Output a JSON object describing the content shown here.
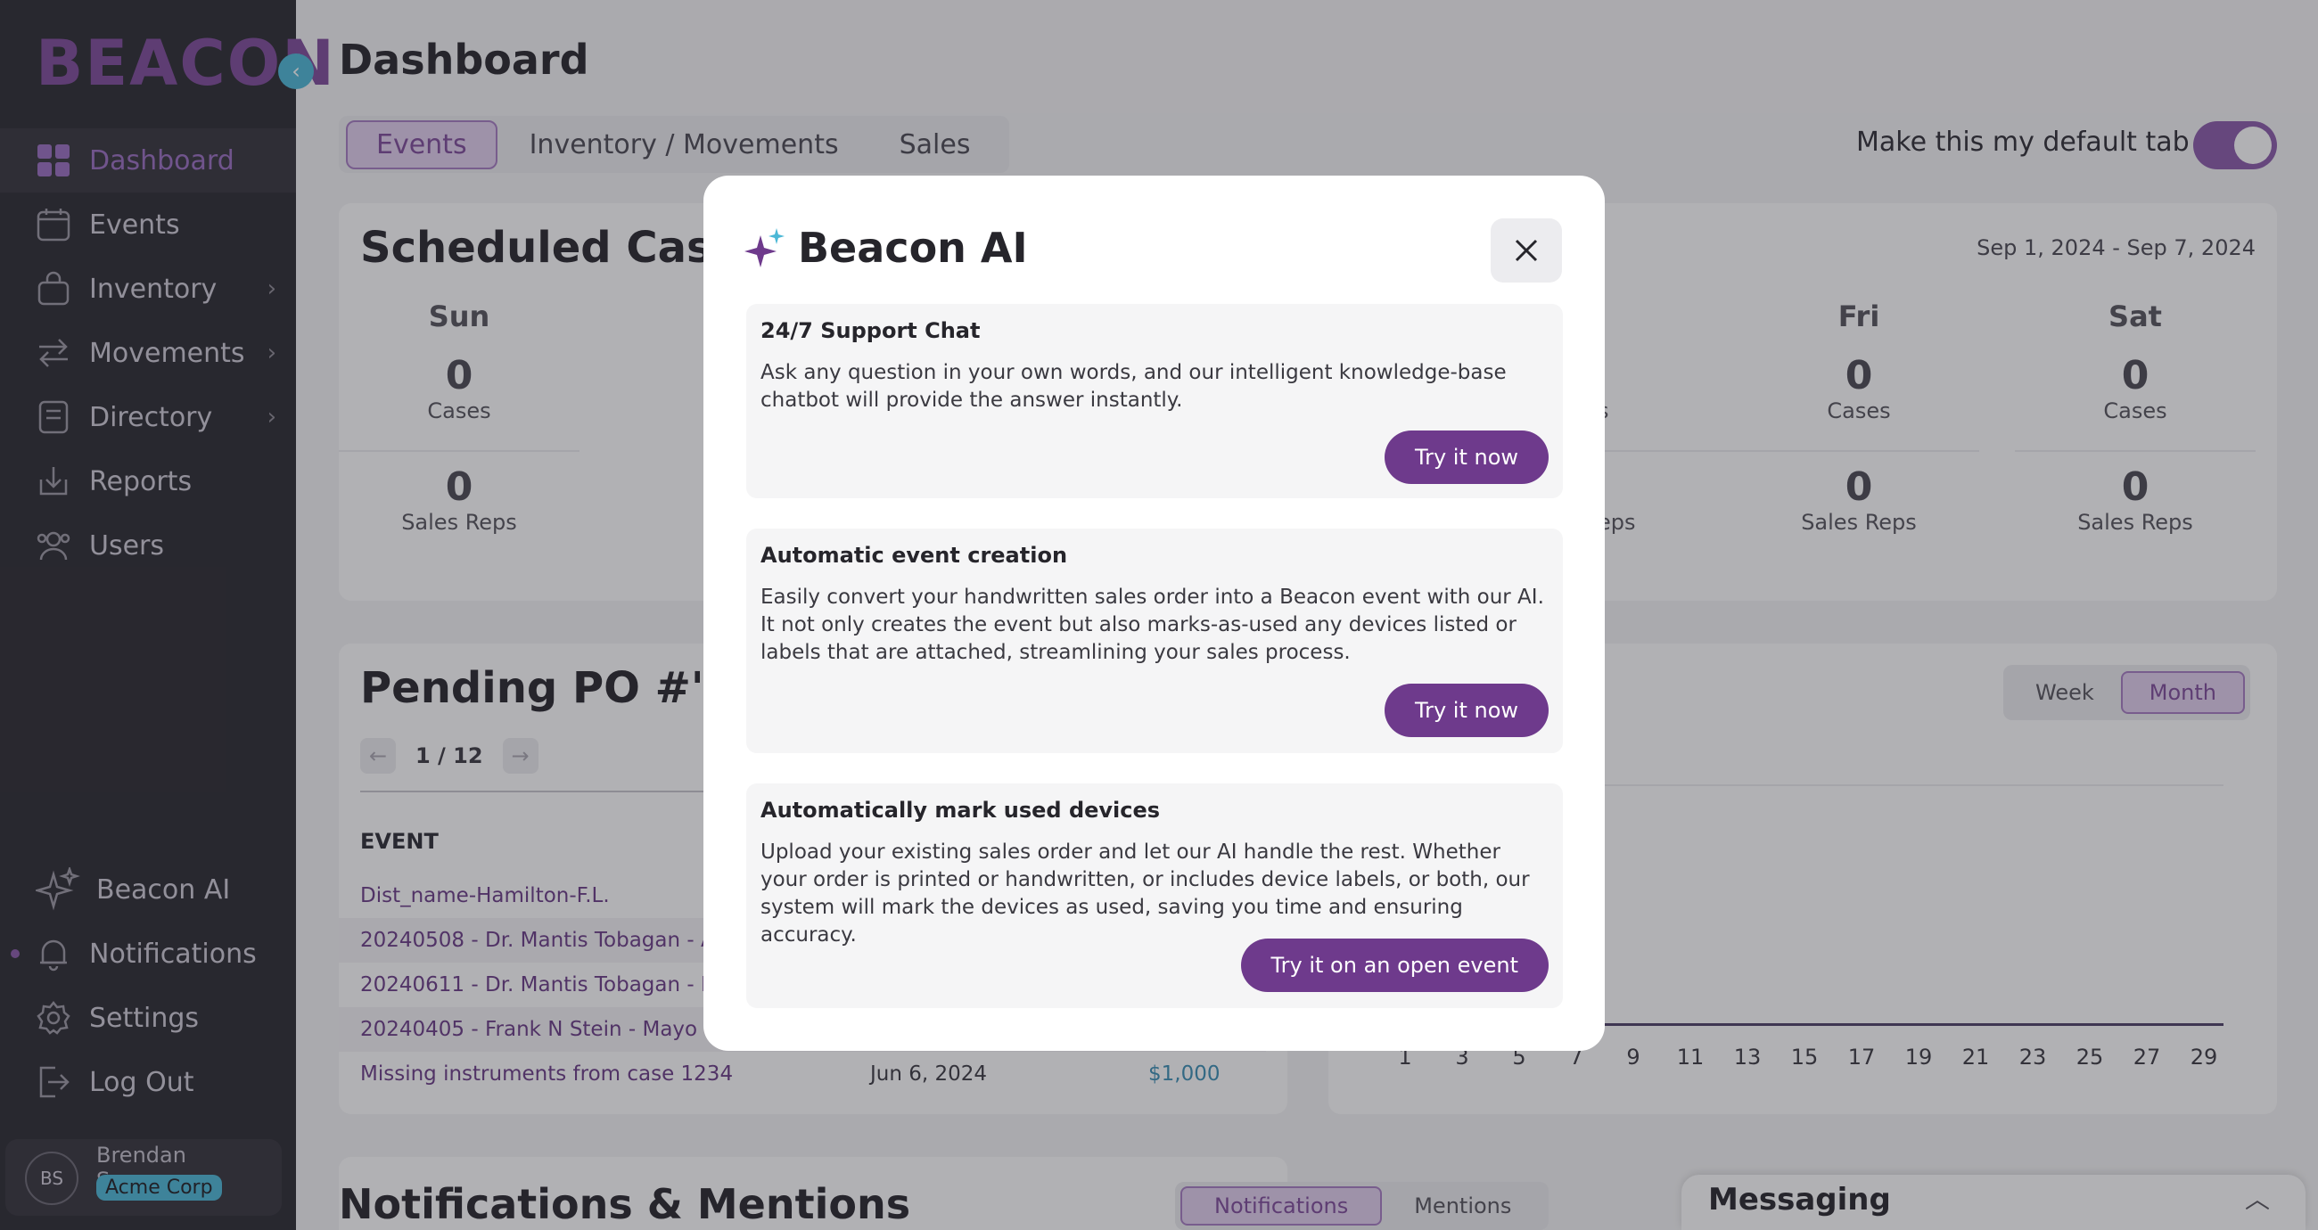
{
  "sidebar": {
    "logo": "BEACON",
    "items": [
      {
        "label": "Dashboard",
        "icon": "dashboard-icon"
      },
      {
        "label": "Events",
        "icon": "calendar-icon"
      },
      {
        "label": "Inventory",
        "icon": "bag-icon"
      },
      {
        "label": "Movements",
        "icon": "arrows-icon"
      },
      {
        "label": "Directory",
        "icon": "book-icon"
      },
      {
        "label": "Reports",
        "icon": "download-icon"
      },
      {
        "label": "Users",
        "icon": "users-icon"
      }
    ],
    "bottom_items": [
      {
        "label": "Beacon AI",
        "icon": "sparkle-icon"
      },
      {
        "label": "Notifications",
        "icon": "bell-icon"
      },
      {
        "label": "Settings",
        "icon": "gear-icon"
      },
      {
        "label": "Log Out",
        "icon": "logout-icon"
      }
    ],
    "user": {
      "initials": "BS",
      "name": "Brendan Sweeney",
      "org": "Acme Corp"
    }
  },
  "header": {
    "title": "Dashboard",
    "tabs": [
      "Events",
      "Inventory / Movements",
      "Sales"
    ],
    "active_tab": "Events",
    "default_tab_label": "Make this my default tab",
    "default_tab_on": true
  },
  "scheduled": {
    "title": "Scheduled Cases",
    "date_range": "Sep 1, 2024 - Sep 7, 2024",
    "days": [
      {
        "name": "Sun",
        "cases": "0",
        "cases_label": "Cases",
        "reps": "0",
        "reps_label": "Sales Reps"
      },
      {
        "name": "Fri",
        "cases": "0",
        "cases_label": "Cases",
        "reps": "0",
        "reps_label": "Sales Reps"
      },
      {
        "name": "Sat",
        "cases": "0",
        "cases_label": "Cases",
        "reps": "0",
        "reps_label": "Sales Reps"
      }
    ],
    "partial": {
      "name": "u",
      "cases_label": "s",
      "reps_label": "eps"
    }
  },
  "pending": {
    "title": "Pending PO #'s",
    "page": "1 / 12",
    "column_event": "EVENT",
    "rows": [
      {
        "event": "Dist_name-Hamilton-F.L.",
        "date": "",
        "amount": ""
      },
      {
        "event": "20240508 - Dr. Mantis Tobagan - A",
        "date": "",
        "amount": ""
      },
      {
        "event": "20240611 - Dr. Mantis Tobagan - De",
        "date": "",
        "amount": ""
      },
      {
        "event": "20240405 - Frank N Stein - Mayo Cl",
        "date": "",
        "amount": ""
      },
      {
        "event": "Missing instruments from case 1234",
        "date": "Jun 6, 2024",
        "amount": "$1,000"
      }
    ]
  },
  "chart_card": {
    "title_fragment": "e",
    "segments": [
      "Week",
      "Month"
    ],
    "active_segment": "Month",
    "x_ticks": [
      "1",
      "3",
      "5",
      "7",
      "9",
      "11",
      "13",
      "15",
      "17",
      "19",
      "21",
      "23",
      "25",
      "27",
      "29"
    ]
  },
  "notifications": {
    "title": "Notifications & Mentions",
    "tabs": [
      "Notifications",
      "Mentions"
    ],
    "active_tab": "Notifications"
  },
  "messaging": {
    "title": "Messaging"
  },
  "modal": {
    "title": "Beacon AI",
    "features": [
      {
        "title": "24/7 Support Chat",
        "description": "Ask any question in your own words, and our intelligent knowledge-base chatbot will provide the answer instantly.",
        "button": "Try it now"
      },
      {
        "title": "Automatic event creation",
        "description": "Easily convert your handwritten sales order into a Beacon event with our AI. It not only creates the event but also marks-as-used any devices listed or labels that are attached, streamlining your sales process.",
        "button": "Try it now"
      },
      {
        "title": "Automatically mark used devices",
        "description": "Upload your existing sales order and let our AI handle the rest. Whether your order is printed or handwritten, or includes device labels, or both, our system will mark the devices as used, saving you time and ensuring accuracy.",
        "button": "Try it on an open event"
      }
    ]
  },
  "colors": {
    "brand_purple": "#7e4a99",
    "button_purple": "#6e3a8c",
    "accent_cyan": "#4bb8d6",
    "sidebar_bg": "#2a2930"
  }
}
